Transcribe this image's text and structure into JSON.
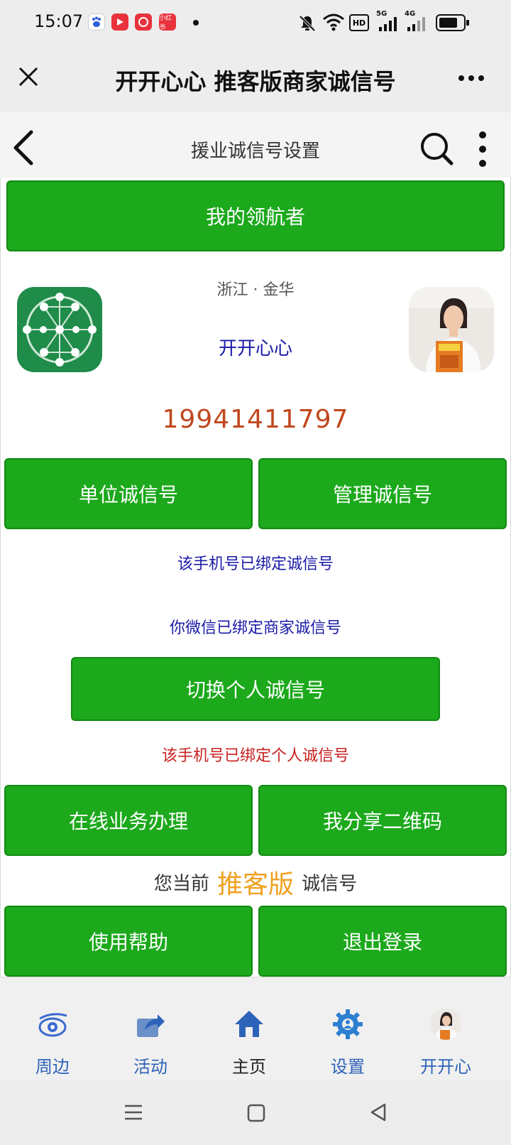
{
  "status_bar": {
    "time": "15:07",
    "apps": [
      "小红书"
    ],
    "indicators": [
      "HD",
      "5G",
      "4G"
    ]
  },
  "wechat_header": {
    "title": "开开心心 推客版商家诚信号"
  },
  "page_header": {
    "title": "援业诚信号设置"
  },
  "main": {
    "navigator_button": "我的领航者",
    "location": "浙江 · 金华",
    "user_name": "开开心心",
    "phone": "19941411797",
    "btn_unit": "单位诚信号",
    "btn_manage": "管理诚信号",
    "msg_phone_bound": "该手机号已绑定诚信号",
    "msg_wechat_bound": "你微信已绑定商家诚信号",
    "btn_switch_personal": "切换个人诚信号",
    "msg_personal_bound": "该手机号已绑定个人诚信号",
    "btn_online_business": "在线业务办理",
    "btn_share_qr": "我分享二维码",
    "version_prefix": "您当前",
    "version_name": "推客版",
    "version_suffix": "诚信号",
    "btn_help": "使用帮助",
    "btn_logout": "退出登录"
  },
  "bottom_nav": {
    "items": [
      {
        "label": "周边",
        "icon": "eye-icon"
      },
      {
        "label": "活动",
        "icon": "share-icon"
      },
      {
        "label": "主页",
        "icon": "home-icon"
      },
      {
        "label": "设置",
        "icon": "gear-icon"
      },
      {
        "label": "开开心",
        "icon": "avatar-icon"
      }
    ]
  },
  "colors": {
    "green_button": "#1ca91c",
    "phone_number": "#c0471e",
    "blue_text": "#1a1aa8",
    "red_text": "#c82020",
    "orange_version": "#f0a020",
    "nav_blue": "#2d63b8"
  }
}
